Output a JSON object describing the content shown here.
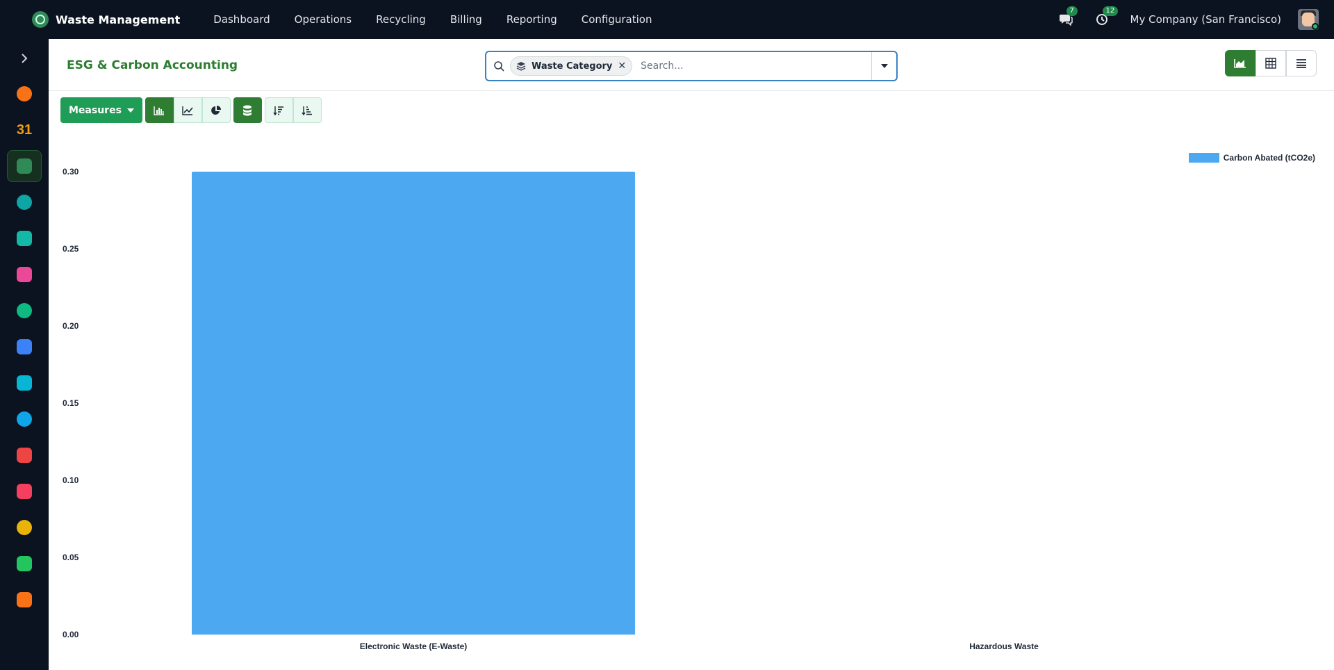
{
  "app": {
    "name": "Waste Management",
    "menu": [
      "Dashboard",
      "Operations",
      "Recycling",
      "Billing",
      "Reporting",
      "Configuration"
    ],
    "messages_count": "7",
    "activities_count": "12",
    "company": "My Company (San Francisco)"
  },
  "sidebar": {
    "apps": [
      {
        "icon": "discuss-icon",
        "color": "#f97316"
      },
      {
        "icon": "calendar-icon",
        "color": "#f59e0b",
        "text": "31"
      },
      {
        "icon": "waste-management-icon",
        "color": "#2f8a57",
        "active": true
      },
      {
        "icon": "contacts-icon",
        "color": "#0ea5a4"
      },
      {
        "icon": "crm-icon",
        "color": "#14b8a6"
      },
      {
        "icon": "dashboards-icon",
        "color": "#ec4899"
      },
      {
        "icon": "recycling-icon",
        "color": "#10b981"
      },
      {
        "icon": "invoicing-icon",
        "color": "#3b82f6"
      },
      {
        "icon": "planning-icon",
        "color": "#06b6d4"
      },
      {
        "icon": "project-icon",
        "color": "#0ea5e9"
      },
      {
        "icon": "inventory-icon",
        "color": "#ef4444"
      },
      {
        "icon": "fleet-icon",
        "color": "#f43f5e"
      },
      {
        "icon": "sign-icon",
        "color": "#eab308"
      },
      {
        "icon": "reporting-icon",
        "color": "#22c55e"
      },
      {
        "icon": "settings-icon",
        "color": "#f97316"
      }
    ]
  },
  "control_panel": {
    "title": "ESG & Carbon Accounting",
    "facet": "Waste Category",
    "search_placeholder": "Search..."
  },
  "toolbar": {
    "measures_label": "Measures"
  },
  "colors": {
    "accent": "#2e7d32",
    "bar": "#4da8f2",
    "topbar": "#0b1220"
  },
  "chart_data": {
    "type": "bar",
    "categories": [
      "Electronic Waste (E-Waste)",
      "Hazardous Waste"
    ],
    "series": [
      {
        "name": "Carbon Abated (tCO2e)",
        "values": [
          0.3,
          0
        ]
      }
    ],
    "ylim": [
      0,
      0.3
    ],
    "yticks": [
      "0.00",
      "0.05",
      "0.10",
      "0.15",
      "0.20",
      "0.25",
      "0.30"
    ],
    "legend_position": "top-right",
    "grid": false
  }
}
